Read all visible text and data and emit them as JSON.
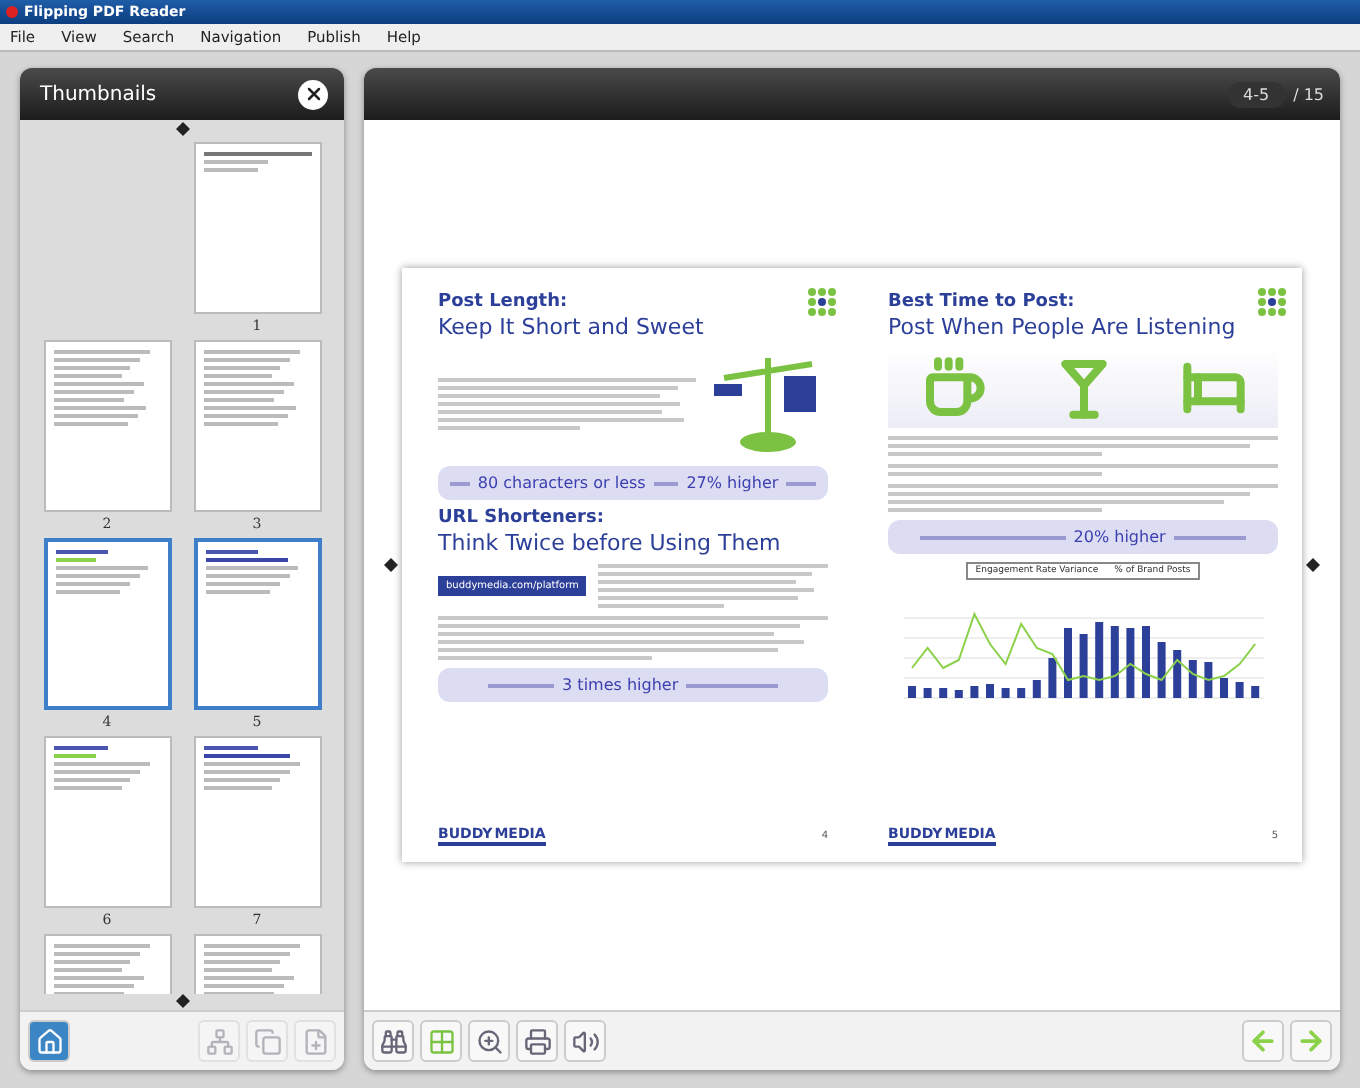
{
  "window": {
    "title": "Flipping PDF Reader"
  },
  "menu": [
    "File",
    "View",
    "Search",
    "Navigation",
    "Publish",
    "Help"
  ],
  "thumbnails_panel": {
    "title": "Thumbnails",
    "items": [
      {
        "page": "1",
        "selected": false,
        "kind": "cover"
      },
      {
        "page": "2",
        "selected": false,
        "kind": "text"
      },
      {
        "page": "3",
        "selected": false,
        "kind": "text"
      },
      {
        "page": "4",
        "selected": true,
        "kind": "green"
      },
      {
        "page": "5",
        "selected": true,
        "kind": "chart"
      },
      {
        "page": "6",
        "selected": false,
        "kind": "green"
      },
      {
        "page": "7",
        "selected": false,
        "kind": "chart"
      },
      {
        "selected": false,
        "kind": "text"
      },
      {
        "selected": false,
        "kind": "text"
      }
    ],
    "tools": [
      {
        "kind": "home",
        "disabled": false
      },
      {
        "kind": "tree",
        "disabled": true
      },
      {
        "kind": "copy",
        "disabled": true
      },
      {
        "kind": "add",
        "disabled": true
      }
    ]
  },
  "viewer": {
    "current": "4-5",
    "total": "/ 15",
    "left_page": {
      "title": "Post Length:",
      "subtitle": "Keep It Short and Sweet",
      "callout": [
        "80 characters or less",
        "27% higher"
      ],
      "title2": "URL Shorteners:",
      "subtitle2": "Think Twice before Using Them",
      "sign": "buddymedia.com/platform",
      "callout2": [
        "3 times higher"
      ],
      "logo": [
        "BUDDY",
        "MEDIA"
      ],
      "number": "4"
    },
    "right_page": {
      "title": "Best Time to Post:",
      "subtitle": "Post When People Are Listening",
      "callout": [
        "20% higher"
      ],
      "legend": [
        "Engagement Rate Variance",
        "% of Brand Posts"
      ],
      "logo": [
        "BUDDY",
        "MEDIA"
      ],
      "number": "5"
    },
    "tools": [
      {
        "kind": "binoculars"
      },
      {
        "kind": "fit"
      },
      {
        "kind": "zoom"
      },
      {
        "kind": "print"
      },
      {
        "kind": "sound"
      }
    ],
    "nav": [
      {
        "kind": "prev"
      },
      {
        "kind": "next"
      }
    ]
  }
}
